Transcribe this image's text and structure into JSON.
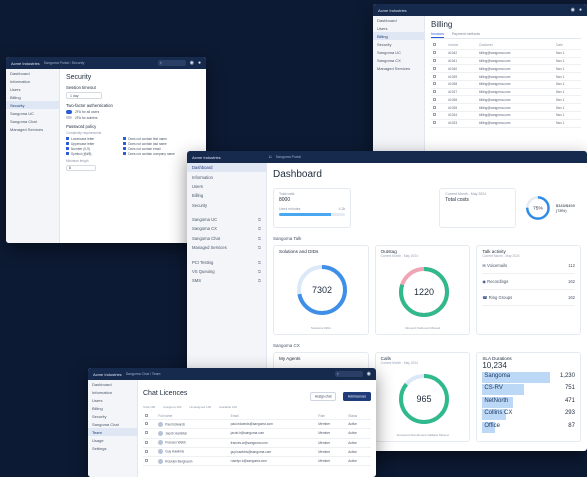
{
  "billing": {
    "title": "Billing",
    "tabs": [
      "Invoices",
      "Payment methods"
    ],
    "sidebar": [
      "Dashboard",
      "Users",
      "Billing",
      "Security",
      "Sangoma UC",
      "Sangoma CX",
      "Managed Services"
    ],
    "columns": [
      "Invoice",
      "Customer",
      "Date"
    ],
    "rows": [
      [
        "#1042",
        "billing@sangoma.com",
        "Nov 1"
      ],
      [
        "#1041",
        "billing@sangoma.com",
        "Nov 1"
      ],
      [
        "#1040",
        "billing@sangoma.com",
        "Nov 1"
      ],
      [
        "#1039",
        "billing@sangoma.com",
        "Nov 1"
      ],
      [
        "#1038",
        "billing@sangoma.com",
        "Nov 1"
      ],
      [
        "#1037",
        "billing@sangoma.com",
        "Nov 1"
      ],
      [
        "#1036",
        "billing@sangoma.com",
        "Nov 1"
      ],
      [
        "#1035",
        "billing@sangoma.com",
        "Nov 1"
      ],
      [
        "#1034",
        "billing@sangoma.com",
        "Nov 1"
      ],
      [
        "#1033",
        "billing@sangoma.com",
        "Nov 1"
      ]
    ]
  },
  "security": {
    "brand": "Acme Industries",
    "crumb": "Sangoma Portal / Security",
    "title": "Security",
    "session_label": "Session timeout",
    "session_value": "1 day",
    "twofa_label": "Two-factor authentication",
    "twofa_options": [
      "2FA for all users",
      "2FA for admins"
    ],
    "pw_label": "Password policy",
    "pw_sub": "Complexity requirements",
    "pw_left": [
      "Lowercase letter",
      "Uppercase letter",
      "Number (0-9)",
      "Symbol (@#$)"
    ],
    "pw_right": [
      "Does not contain first name",
      "Does not contain last name",
      "Does not contain email",
      "Does not contain company name"
    ],
    "minlen_label": "Minimum length",
    "minlen_value": "8",
    "sidebar": [
      "Dashboard",
      "Information",
      "Users",
      "Billing",
      "Security",
      "Sangoma UC",
      "Sangoma Chat",
      "Managed Services"
    ]
  },
  "dashboard": {
    "brand": "Acme Industries",
    "crumb": "Sangoma Portal",
    "title": "Dashboard",
    "sidebar": [
      {
        "label": "Dashboard",
        "active": true,
        "ext": false
      },
      {
        "label": "Information",
        "active": false,
        "ext": false
      },
      {
        "label": "Users",
        "active": false,
        "ext": false
      },
      {
        "label": "Billing",
        "active": false,
        "ext": false
      },
      {
        "label": "Security",
        "active": false,
        "ext": false
      },
      {
        "label": "Sangoma UC",
        "active": false,
        "ext": true
      },
      {
        "label": "Sangoma CX",
        "active": false,
        "ext": true
      },
      {
        "label": "Sangoma Chat",
        "active": false,
        "ext": true
      },
      {
        "label": "Managed Services",
        "active": false,
        "ext": true
      },
      {
        "label": "PCI Testing",
        "active": false,
        "ext": true
      },
      {
        "label": "VS Queuing",
        "active": false,
        "ext": true
      },
      {
        "label": "SMS",
        "active": false,
        "ext": true
      }
    ],
    "kpi_total_calls_label": "Total calls",
    "kpi_total_calls": "8000",
    "kpi_used_label": "Used minutes",
    "kpi_used_value": "4,2k",
    "kpi_used_pct": 0.78,
    "kpi_current_month": "Current Month - May 2024",
    "kpi_total_costs_label": "Total costs",
    "kpi_ring_pct": "75%",
    "kpi_ring_value": "$345/$459 (78%)",
    "kpi_ring_fraction": 0.75,
    "group_uc": "Sangoma Talk",
    "group_cx": "Sangoma CX",
    "card1": {
      "title": "Solutions and DIDs",
      "value": "7302",
      "legend": "Solutions  DIDs",
      "fraction": 0.72
    },
    "card2": {
      "title": "Outstag",
      "sub": "Current Month - May 2024",
      "value": "1220",
      "legend": "Inbound  Outbound  Missed",
      "fraction": 0.8
    },
    "activity": {
      "title": "Talk activity",
      "sub": "Current Month - May 2024",
      "rows": [
        [
          "Voicemails",
          "112"
        ],
        [
          "Recordings",
          "162"
        ],
        [
          "Ring Groups",
          "162"
        ]
      ]
    },
    "agents_title": "My Agents",
    "calls": {
      "title": "Calls",
      "sub": "Current Month - May 2024",
      "value": "965",
      "legend": "Answered  Abandoned  Callback  Missed",
      "fraction": 0.86
    },
    "sla": {
      "title": "SLA Durations",
      "total": "10,234",
      "rows": [
        [
          "Sangoma",
          "1,230",
          0.73
        ],
        [
          "CS-RV",
          "751",
          0.45
        ],
        [
          "NetNorth",
          "471",
          0.33
        ],
        [
          "Collins CX",
          "293",
          0.25
        ],
        [
          "Office",
          "87",
          0.14
        ]
      ]
    }
  },
  "chat": {
    "brand": "Acme Industries",
    "crumb": "Sangoma Chat / Team",
    "title": "Chat Licences",
    "btn_secondary": "Assign chat",
    "btn_primary": "Add licences",
    "stats": [
      "Total 100",
      "Assigned 100",
      "Unassigned 100",
      "Available 100"
    ],
    "search_placeholder": "Search",
    "columns": [
      "Full name",
      "Email",
      "Role",
      "Status"
    ],
    "rows": [
      [
        "Paul Edwards",
        "paul.edwards@sangoma.com",
        "Member",
        "Active"
      ],
      [
        "Jacob Hamilton",
        "jacob.h@sangoma.com",
        "Member",
        "Active"
      ],
      [
        "Frances Webb",
        "frances.w@sangoma.com",
        "Member",
        "Active"
      ],
      [
        "Guy Hawkins",
        "guy.hawkins@sangoma.com",
        "Member",
        "Active"
      ],
      [
        "Roselyn Bergnaum",
        "roselyn.b@sangoma.com",
        "Member",
        "Active"
      ]
    ],
    "sidebar": [
      "Dashboard",
      "Information",
      "Users",
      "Billing",
      "Security",
      "Sangoma Chat",
      "Team",
      "Usage",
      "Settings"
    ]
  }
}
